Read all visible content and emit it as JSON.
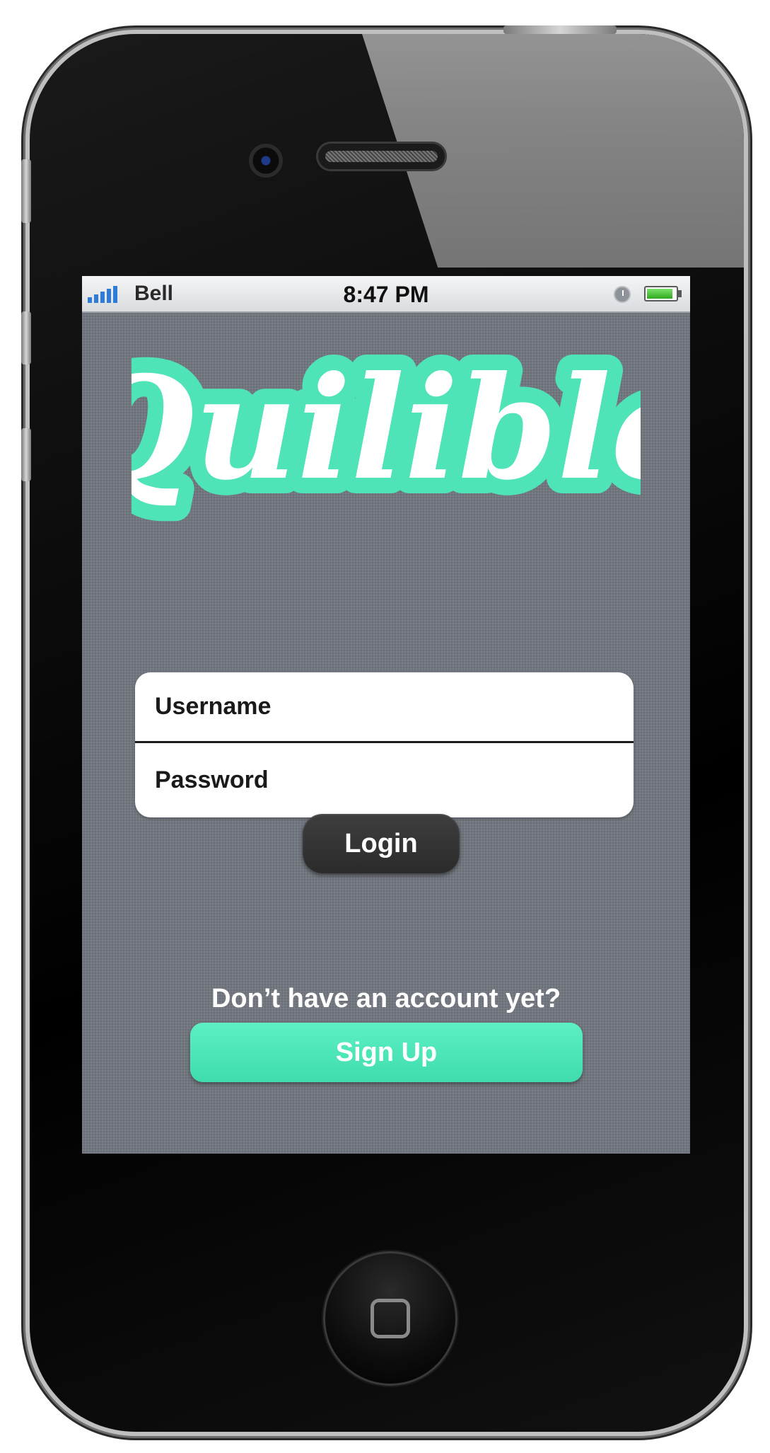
{
  "status_bar": {
    "carrier": "Bell",
    "time": "8:47 PM",
    "signal_bars": 5,
    "battery_level": 0.9
  },
  "app": {
    "logo_text": "Quilible",
    "brand_color": "#4fe3b8",
    "background_color": "#71767f"
  },
  "login_form": {
    "username_placeholder": "Username",
    "password_placeholder": "Password",
    "login_label": "Login"
  },
  "signup": {
    "prompt": "Don’t have an account yet?",
    "button_label": "Sign Up"
  },
  "icons": {
    "signal": "signal-bars-icon",
    "clock": "clock-icon",
    "battery": "battery-icon",
    "home": "home-button-icon"
  }
}
